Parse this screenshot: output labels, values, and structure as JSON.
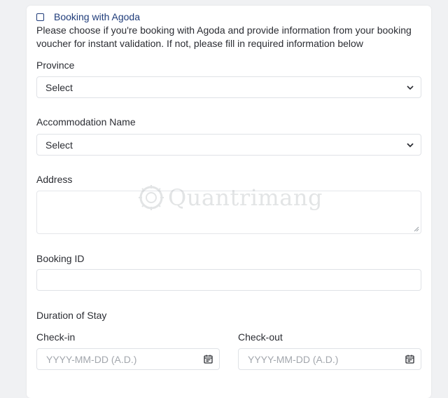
{
  "agoda": {
    "label": "Booking with Agoda",
    "checked": false,
    "description": "Please choose if you're booking with Agoda and provide information from your booking voucher for instant validation. If not, please fill in required information below"
  },
  "province": {
    "label": "Province",
    "value": "Select"
  },
  "accommodation": {
    "label": "Accommodation Name",
    "value": "Select"
  },
  "address": {
    "label": "Address",
    "value": ""
  },
  "booking_id": {
    "label": "Booking ID",
    "value": ""
  },
  "stay": {
    "heading": "Duration of Stay",
    "checkin": {
      "label": "Check-in",
      "placeholder": "YYYY-MM-DD (A.D.)"
    },
    "checkout": {
      "label": "Check-out",
      "placeholder": "YYYY-MM-DD (A.D.)"
    }
  },
  "watermark": {
    "text": "Quantrimang"
  },
  "icons": {
    "dropdown": "chevron-down-icon",
    "calendar": "calendar-icon",
    "checkbox": "checkbox-unchecked"
  },
  "colors": {
    "accent": "#1f3c7a",
    "border": "#dfe2e6",
    "placeholder": "#a3a7ad",
    "background": "#f0f1f3"
  }
}
